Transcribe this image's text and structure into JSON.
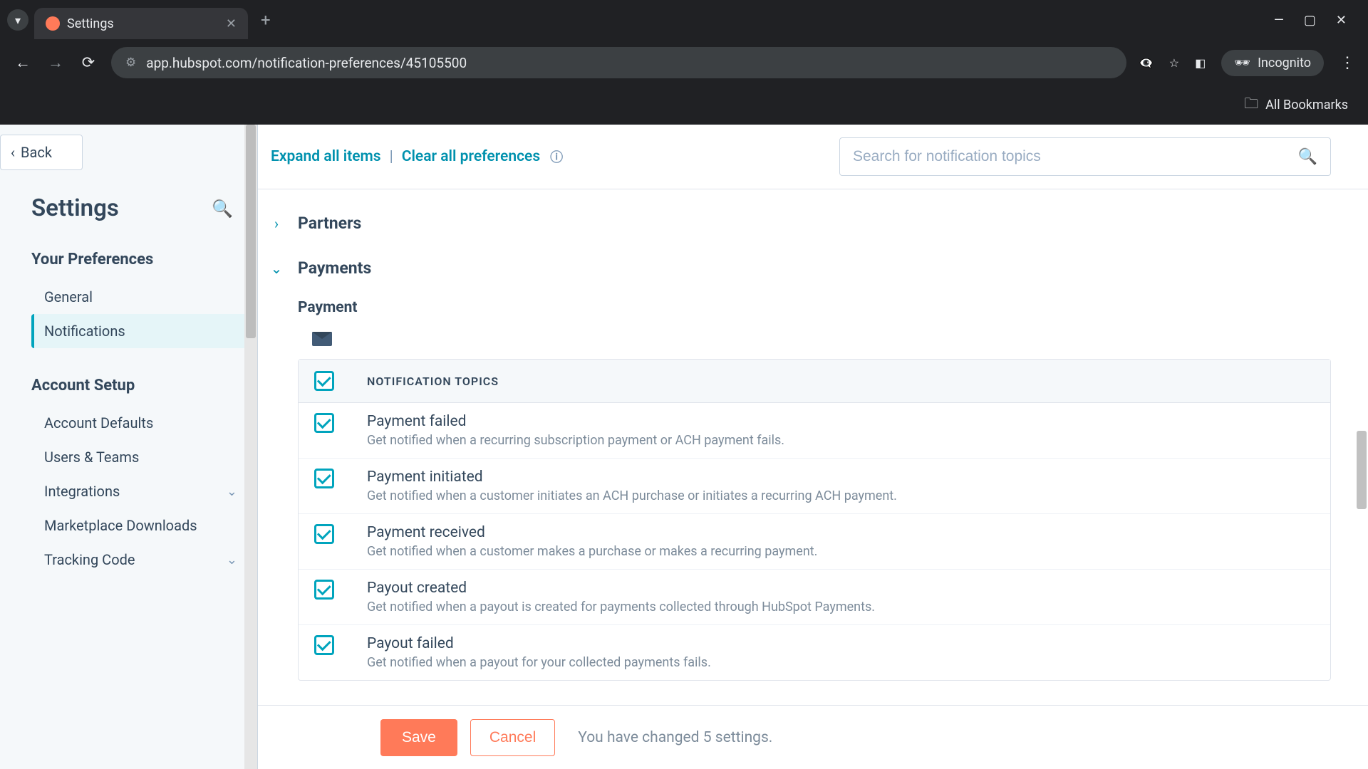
{
  "browser": {
    "tab_title": "Settings",
    "url": "app.hubspot.com/notification-preferences/45105500",
    "incognito_label": "Incognito",
    "all_bookmarks": "All Bookmarks"
  },
  "sidebar": {
    "back_label": "Back",
    "title": "Settings",
    "sections": {
      "prefs": {
        "heading": "Your Preferences",
        "items": [
          "General",
          "Notifications"
        ]
      },
      "account": {
        "heading": "Account Setup",
        "items": [
          "Account Defaults",
          "Users & Teams",
          "Integrations",
          "Marketplace Downloads",
          "Tracking Code"
        ]
      }
    }
  },
  "toolbar": {
    "expand": "Expand all items",
    "clear": "Clear all preferences",
    "search_placeholder": "Search for notification topics"
  },
  "categories": {
    "partners": "Partners",
    "payments": "Payments"
  },
  "payments": {
    "subsection": "Payment",
    "table_header": "NOTIFICATION TOPICS",
    "topics": [
      {
        "title": "Payment failed",
        "desc": "Get notified when a recurring subscription payment or ACH payment fails."
      },
      {
        "title": "Payment initiated",
        "desc": "Get notified when a customer initiates an ACH purchase or initiates a recurring ACH payment."
      },
      {
        "title": "Payment received",
        "desc": "Get notified when a customer makes a purchase or makes a recurring payment."
      },
      {
        "title": "Payout created",
        "desc": "Get notified when a payout is created for payments collected through HubSpot Payments."
      },
      {
        "title": "Payout failed",
        "desc": "Get notified when a payout for your collected payments fails."
      }
    ]
  },
  "footer": {
    "save": "Save",
    "cancel": "Cancel",
    "status": "You have changed 5 settings."
  }
}
